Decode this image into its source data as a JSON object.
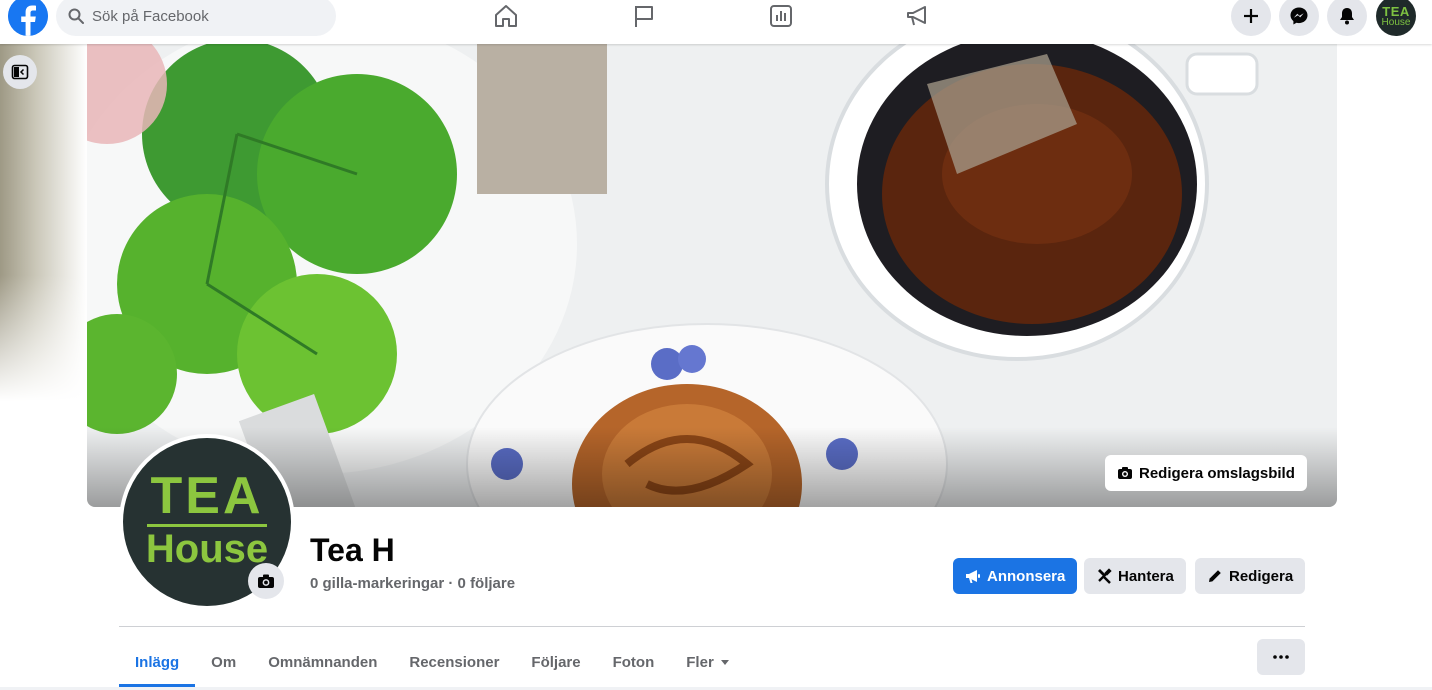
{
  "topbar": {
    "search_placeholder": "Sök på Facebook",
    "nav_icons": [
      "home-icon",
      "flag-icon",
      "insights-icon",
      "megaphone-icon"
    ],
    "right_icons": [
      "plus-icon",
      "messenger-icon",
      "bell-icon"
    ],
    "avatar_text_top": "TEA",
    "avatar_text_bottom": "House"
  },
  "cover": {
    "edit_label": "Redigera omslagsbild"
  },
  "profile": {
    "logo_top": "TEA",
    "logo_bottom": "House",
    "name": "Tea H",
    "stats": "0 gilla-markeringar · 0 följare"
  },
  "actions": {
    "advertise": "Annonsera",
    "manage": "Hantera",
    "edit": "Redigera"
  },
  "tabs": [
    {
      "label": "Inlägg",
      "active": true
    },
    {
      "label": "Om"
    },
    {
      "label": "Omnämnanden"
    },
    {
      "label": "Recensioner"
    },
    {
      "label": "Följare"
    },
    {
      "label": "Foton"
    },
    {
      "label": "Fler"
    }
  ],
  "colors": {
    "brand": "#1877f2",
    "button_blue": "#1b74e4",
    "logo_green": "#8cc63f",
    "logo_bg": "#263232"
  }
}
